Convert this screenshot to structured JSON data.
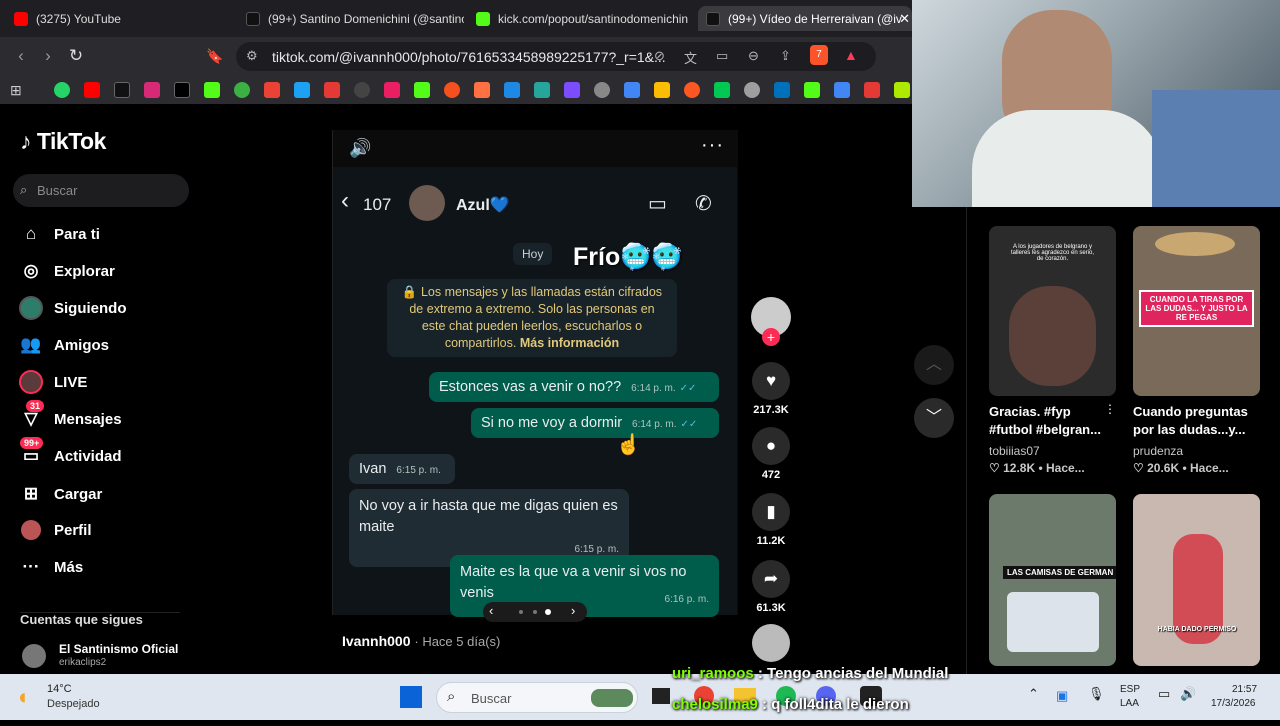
{
  "browser": {
    "tabs": [
      {
        "title": "(3275) YouTube",
        "color": "#ff0000"
      },
      {
        "title": "(99+) Santino Domenichini (@santino",
        "color": "#111111"
      },
      {
        "title": "kick.com/popout/santinodomenichin",
        "color": "#53fc18"
      },
      {
        "title": "(99+) Vídeo de Herreraivan (@iv",
        "color": "#111111"
      }
    ],
    "url": "tiktok.com/@ivannh000/photo/7616533458989225177?_r=1&...",
    "shield_count": "7"
  },
  "tiktok": {
    "logo": "TikTok",
    "search_placeholder": "Buscar",
    "nav": [
      {
        "label": "Para ti",
        "icon": "home-icon"
      },
      {
        "label": "Explorar",
        "icon": "compass-icon"
      },
      {
        "label": "Siguiendo",
        "icon": "following-avatar-icon"
      },
      {
        "label": "Amigos",
        "icon": "friends-icon"
      },
      {
        "label": "LIVE",
        "icon": "live-icon"
      },
      {
        "label": "Mensajes",
        "icon": "messages-icon",
        "badge": "31"
      },
      {
        "label": "Actividad",
        "icon": "activity-icon",
        "badge": "99+"
      },
      {
        "label": "Cargar",
        "icon": "upload-icon"
      },
      {
        "label": "Perfil",
        "icon": "profile-icon"
      },
      {
        "label": "Más",
        "icon": "more-icon"
      }
    ],
    "following_header": "Cuentas que sigues",
    "following": [
      {
        "name": "El Santinismo Oficial",
        "handle": "erikaclips2"
      }
    ],
    "post": {
      "author": "Ivannh000",
      "time": "· Hace 5 día(s)"
    },
    "actions": {
      "likes": "217.3K",
      "comments": "472",
      "saves": "11.2K",
      "shares": "61.3K"
    }
  },
  "chat": {
    "back_count": "107",
    "contact": "Azul💙",
    "date_chip": "Hoy",
    "overlay_text": "Frío🥶🥶",
    "encryption_notice": "🔒 Los mensajes y las llamadas están cifrados de extremo a extremo. Solo las personas en este chat pueden leerlos, escucharlos o compartirlos.",
    "encryption_link": "Más información",
    "messages": [
      {
        "text": "Estonces vas a venir o no??",
        "time": "6:14 p. m.",
        "dir": "out"
      },
      {
        "text": "Si no me voy a dormir",
        "time": "6:14 p. m.",
        "dir": "out"
      },
      {
        "text": "Ivan",
        "time": "6:15 p. m.",
        "dir": "in"
      },
      {
        "text": "No voy a ir hasta que me digas quien es maite",
        "time": "6:15 p. m.",
        "dir": "in"
      },
      {
        "text": "Maite es la que va a venir si vos no venis",
        "time": "6:16 p. m.",
        "dir": "out"
      }
    ]
  },
  "recommended": [
    {
      "title": "Gracias. #fyp #futbol #belgran...",
      "author": "tobiiias07",
      "views": "12.8K • Hace...",
      "thumb_text": "A los jugadores de belgrano y talleres les agradezco en serio, de corazón.",
      "color": "#2b2b2b"
    },
    {
      "title": "Cuando preguntas por las dudas...y...",
      "author": "prudenza",
      "views": "20.6K • Hace...",
      "thumb_text": "CUANDO LA TIRAS POR LAS DUDAS... Y JUSTO LA RE PEGAS",
      "color": "#8a7a6a"
    },
    {
      "title": "",
      "author": "",
      "views": "",
      "thumb_text": "LAS CAMISAS DE GERMAN",
      "color": "#6b7a6a"
    },
    {
      "title": "",
      "author": "",
      "views": "",
      "thumb_text": "HABIA DADO PERMISO",
      "color": "#c9b8b0"
    }
  ],
  "stream_chat": [
    {
      "user": "uri_ramoos",
      "msg": " : Tengo ancias del Mundial",
      "color": "#7fff00"
    },
    {
      "user": "chelosilma9",
      "msg": " : q foll4dita le dieron",
      "color": "#7fff00"
    }
  ],
  "taskbar": {
    "weather_temp": "14°C",
    "weather_desc": "Despejado",
    "search": "Buscar",
    "lang1": "ESP",
    "lang2": "LAA",
    "time": "21:57",
    "date": "17/3/2026"
  }
}
